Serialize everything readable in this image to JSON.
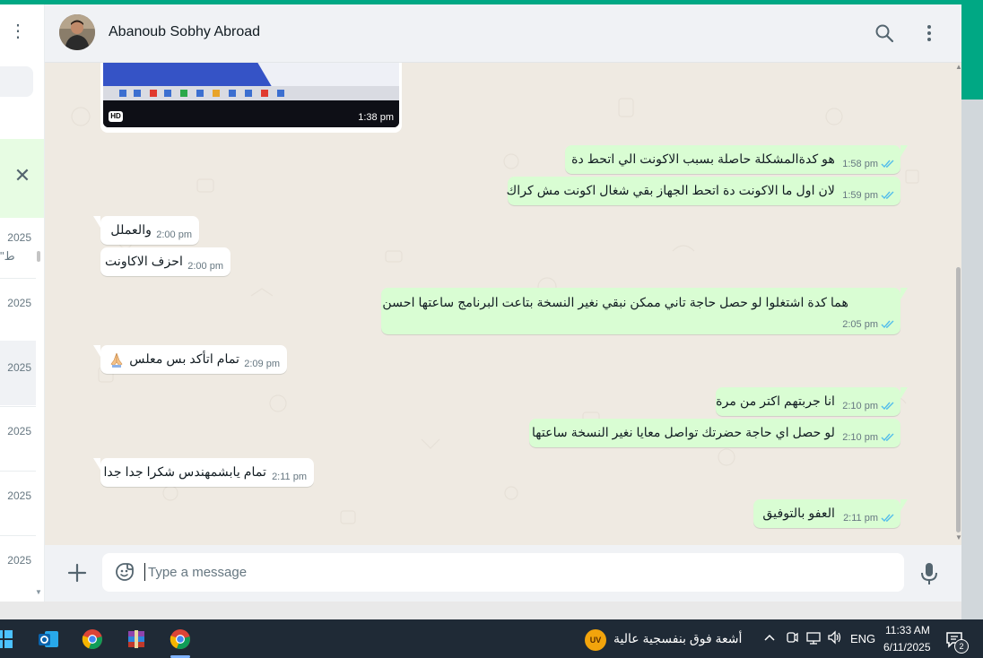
{
  "chat": {
    "contact_name": "Abanoub Sobhy Abroad",
    "image_message": {
      "badge": "HD",
      "time": "1:38 pm"
    },
    "messages": [
      {
        "dir": "out",
        "text": "هو كدةالمشكلة حاصلة بسبب الاكونت الي اتحط دة",
        "time": "1:58 pm",
        "status": "read"
      },
      {
        "dir": "out",
        "text": "لان اول ما الاكونت دة اتحط الجهاز بقي شغال اكونت مش كراك",
        "time": "1:59 pm",
        "status": "read"
      },
      {
        "dir": "in",
        "text": "والعملل",
        "time": "2:00 pm"
      },
      {
        "dir": "in",
        "text": "احزف الاكاونت",
        "time": "2:00 pm"
      },
      {
        "dir": "out",
        "text": "هما كدة اشتغلوا لو حصل حاجة تاني ممكن نبقي نغير النسخة بتاعت البرنامج ساعتها احسن",
        "time": "2:05 pm",
        "status": "read"
      },
      {
        "dir": "in",
        "text": "تمام اتأكد بس معلس",
        "emoji": "folded-hands",
        "time": "2:09 pm"
      },
      {
        "dir": "out",
        "text": "انا جربتهم اكتر من مرة",
        "time": "2:10 pm",
        "status": "read"
      },
      {
        "dir": "out",
        "text": "لو حصل اي حاجة حضرتك تواصل معايا نغير النسخة ساعتها",
        "time": "2:10 pm",
        "status": "read"
      },
      {
        "dir": "in",
        "text": "تمام يابشمهندس شكرا جدا جدا",
        "time": "2:11 pm"
      },
      {
        "dir": "out",
        "text": "العفو بالتوفيق",
        "time": "2:11 pm",
        "status": "read"
      }
    ]
  },
  "composer": {
    "placeholder": "Type a message"
  },
  "sidebar": {
    "chat_dates": [
      "2025",
      "2025",
      "2025",
      "2025",
      "2025",
      "2025"
    ],
    "preview_fragment": "\"ط"
  },
  "taskbar": {
    "weather_badge": "UV",
    "weather_text": "أشعة فوق بنفسجية عالية",
    "language": "ENG",
    "time": "11:33 AM",
    "date": "6/11/2025",
    "notification_count": "2"
  },
  "colors": {
    "accent": "#00a884",
    "outgoing_bubble": "#d9fdd3",
    "incoming_bubble": "#ffffff",
    "chat_background": "#efeae2",
    "read_ticks": "#53bdeb"
  },
  "icons": [
    "menu-dots-icon",
    "close-icon",
    "search-icon",
    "menu-icon",
    "plus-icon",
    "sticker-icon",
    "mic-icon",
    "double-check-icon",
    "windows-start-icon",
    "outlook-icon",
    "chrome-icon",
    "winrar-icon",
    "chevron-up-icon",
    "notification-icon"
  ]
}
